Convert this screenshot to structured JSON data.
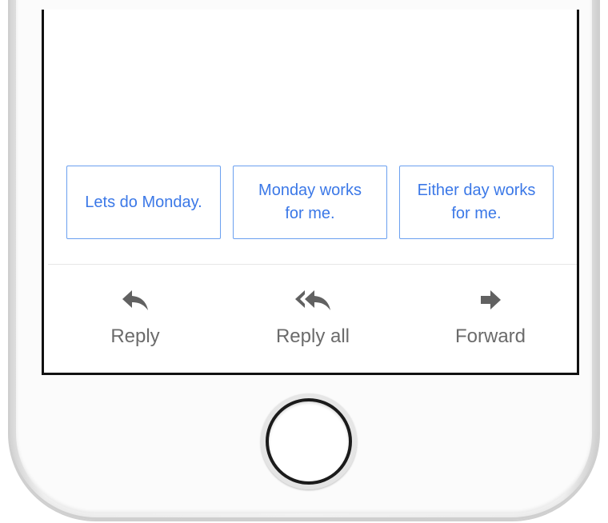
{
  "smart_replies": [
    {
      "text": "Lets do Monday."
    },
    {
      "text": "Monday works\nfor me."
    },
    {
      "text": "Either day works\nfor me."
    }
  ],
  "actions": [
    {
      "label": "Reply",
      "icon": "reply-icon"
    },
    {
      "label": "Reply all",
      "icon": "reply-all-icon"
    },
    {
      "label": "Forward",
      "icon": "forward-icon"
    }
  ],
  "colors": {
    "accent": "#3b78e7",
    "chip_border": "#6aa0f0",
    "action_text": "#6b6b6b",
    "icon": "#616161"
  }
}
